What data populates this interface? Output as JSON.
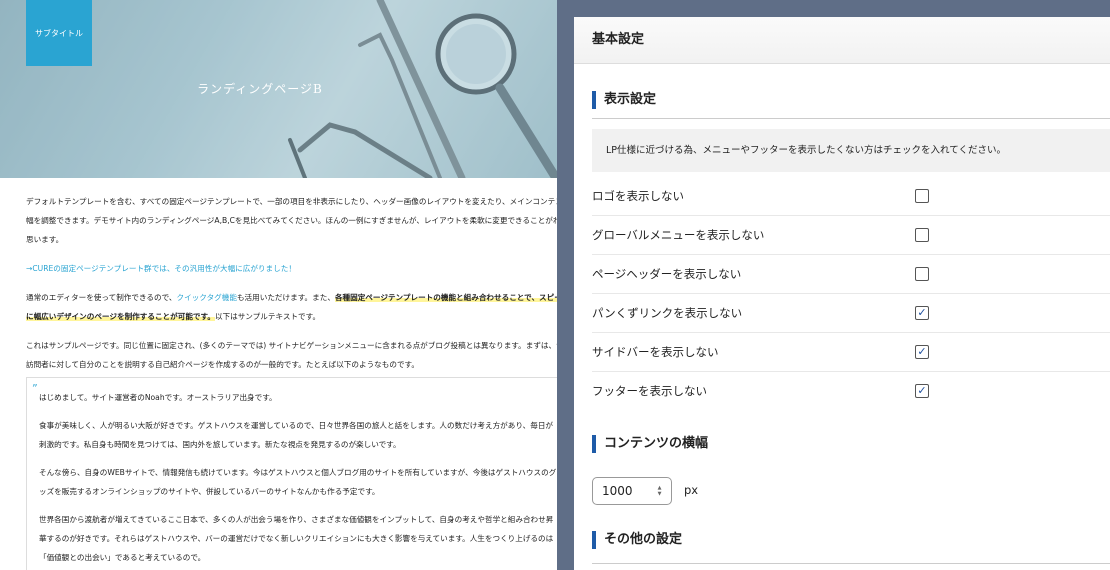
{
  "page_preview": {
    "subtitle_badge": "サブタイトル",
    "hero_title": "ランディングページB",
    "paragraph1": "デフォルトテンプレートを含む、すべての固定ページテンプレートで、一部の項目を非表示にしたり、ヘッダー画像のレイアウトを変えたり、メインコンテンツの横幅を調整できます。デモサイト内のランディングページA,B,Cを見比べてみてください。ほんの一例にすぎませんが、レイアウトを柔軟に変更できることがわかると思います。",
    "link_line": "→CUREの固定ページテンプレート群では、その汎用性が大幅に広がりました！",
    "paragraph3_a": "通常のエディターを使って制作できるので、",
    "paragraph3_link": "クイックタグ機能",
    "paragraph3_b": "も活用いただけます。また、",
    "paragraph3_hl": "各種固定ページテンプレートの機能と組み合わせることで、スピーディーに幅広いデザインのページを制作することが可能です。",
    "paragraph3_c": "以下はサンプルテキストです。",
    "paragraph4": "これはサンプルページです。同じ位置に固定され、(多くのテーマでは) サイトナビゲーションメニューに含まれる点がブログ投稿とは異なります。まずは、サイト訪問者に対して自分のことを説明する自己紹介ページを作成するのが一般的です。たとえば以下のようなものです。",
    "quote_mark": "”",
    "quote": [
      "はじめまして。サイト運営者のNoahです。オーストラリア出身です。",
      "食事が美味しく、人が明るい大阪が好きです。ゲストハウスを運営しているので、日々世界各国の旅人と話をします。人の数だけ考え方があり、毎日が刺激的です。私自身も時間を見つけては、国内外を旅しています。新たな視点を発見するのが楽しいです。",
      "そんな傍ら、自身のWEBサイトで、情報発信も続けています。今はゲストハウスと個人ブログ用のサイトを所有していますが、今後はゲストハウスのグッズを販売するオンラインショップのサイトや、併設しているバーのサイトなんかも作る予定です。",
      "世界各国から渡航者が増えてきているここ日本で、多くの人が出会う場を作り、さまざまな価値観をインプットして、自身の考えや哲学と組み合わせ昇華するのが好きです。それらはゲストハウスや、バーの運営だけでなく新しいクリエイションにも大きく影響を与えています。人生をつくり上げるのは「価値観との出会い」であると考えているので。"
    ]
  },
  "settings_panel": {
    "title": "基本設定",
    "display_section": {
      "title": "表示設定",
      "notice": "LP仕様に近づける為、メニューやフッターを表示したくない方はチェックを入れてください。",
      "options": [
        {
          "label": "ロゴを表示しない",
          "checked": false
        },
        {
          "label": "グローバルメニューを表示しない",
          "checked": false
        },
        {
          "label": "ページヘッダーを表示しない",
          "checked": false
        },
        {
          "label": "パンくずリンクを表示しない",
          "checked": true
        },
        {
          "label": "サイドバーを表示しない",
          "checked": true
        },
        {
          "label": "フッターを表示しない",
          "checked": true
        }
      ]
    },
    "width_section": {
      "title": "コンテンツの横幅",
      "value": "1000",
      "unit": "px"
    },
    "other_section": {
      "title": "その他の設定"
    }
  },
  "colors": {
    "accent": "#1e5ba8",
    "link": "#2aa4d2",
    "background": "#5f6e87"
  }
}
